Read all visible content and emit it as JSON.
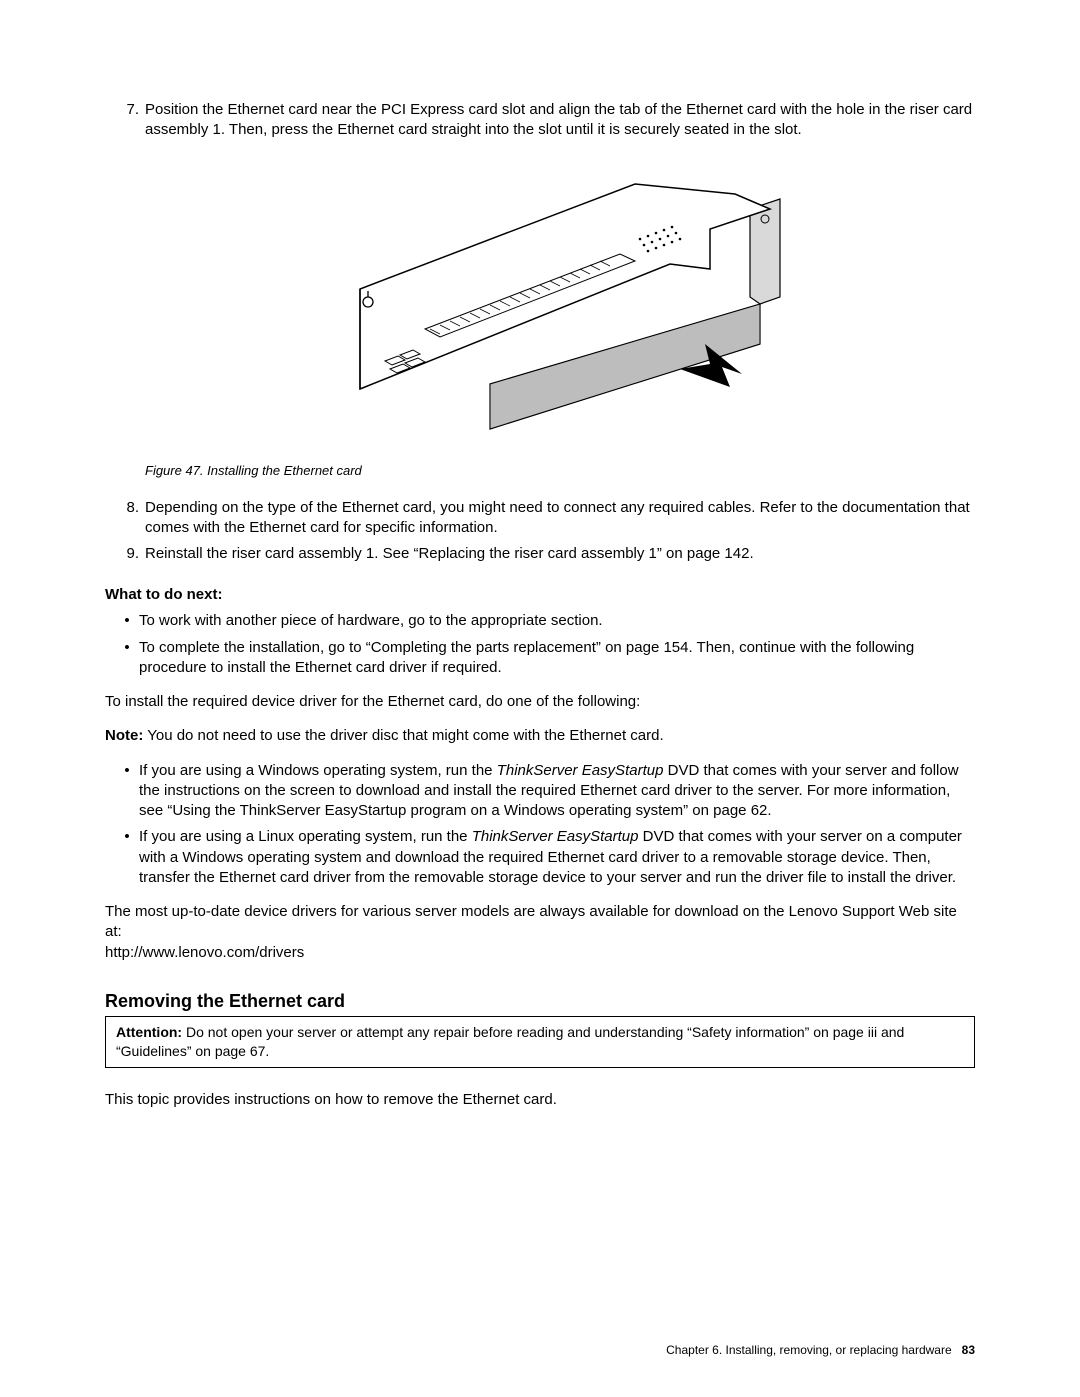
{
  "steps": {
    "s7": {
      "num": "7.",
      "text": "Position the Ethernet card near the PCI Express card slot and align the tab of the Ethernet card with the hole in the riser card assembly 1. Then, press the Ethernet card straight into the slot until it is securely seated in the slot."
    },
    "s8": {
      "num": "8.",
      "text": "Depending on the type of the Ethernet card, you might need to connect any required cables. Refer to the documentation that comes with the Ethernet card for specific information."
    },
    "s9": {
      "num": "9.",
      "text": "Reinstall the riser card assembly 1. See “Replacing the riser card assembly 1” on page 142."
    }
  },
  "figure": {
    "caption": "Figure 47.  Installing the Ethernet card"
  },
  "what_next_label": "What to do next:",
  "what_next": {
    "b1": "To work with another piece of hardware, go to the appropriate section.",
    "b2": "To complete the installation, go to “Completing the parts replacement” on page 154. Then, continue with the following procedure to install the Ethernet card driver if required."
  },
  "driver_intro": "To install the required device driver for the Ethernet card, do one of the following:",
  "note": {
    "label": "Note:",
    "text": " You do not need to use the driver disc that might come with the Ethernet card."
  },
  "driver_bullets": {
    "win": {
      "pre": "If you are using a Windows operating system, run the ",
      "em": "ThinkServer EasyStartup",
      "post": " DVD that comes with your server and follow the instructions on the screen to download and install the required Ethernet card driver to the server. For more information, see “Using the ThinkServer EasyStartup program on a Windows operating system” on page 62."
    },
    "lin": {
      "pre": "If you are using a Linux operating system, run the ",
      "em": "ThinkServer EasyStartup",
      "post": " DVD that comes with your server on a computer with a Windows operating system and download the required Ethernet card driver to a removable storage device. Then, transfer the Ethernet card driver from the removable storage device to your server and run the driver file to install the driver."
    }
  },
  "drivers_site": {
    "text": "The most up-to-date device drivers for various server models are always available for download on the Lenovo Support Web site at:",
    "url": "http://www.lenovo.com/drivers"
  },
  "h2": "Removing the Ethernet card",
  "attention": {
    "label": "Attention:",
    "text": " Do not open your server or attempt any repair before reading and understanding “Safety information” on page iii and “Guidelines” on page 67."
  },
  "topic_intro": "This topic provides instructions on how to remove the Ethernet card.",
  "footer": {
    "chapter": "Chapter 6.  Installing, removing, or replacing hardware",
    "page": "83"
  }
}
